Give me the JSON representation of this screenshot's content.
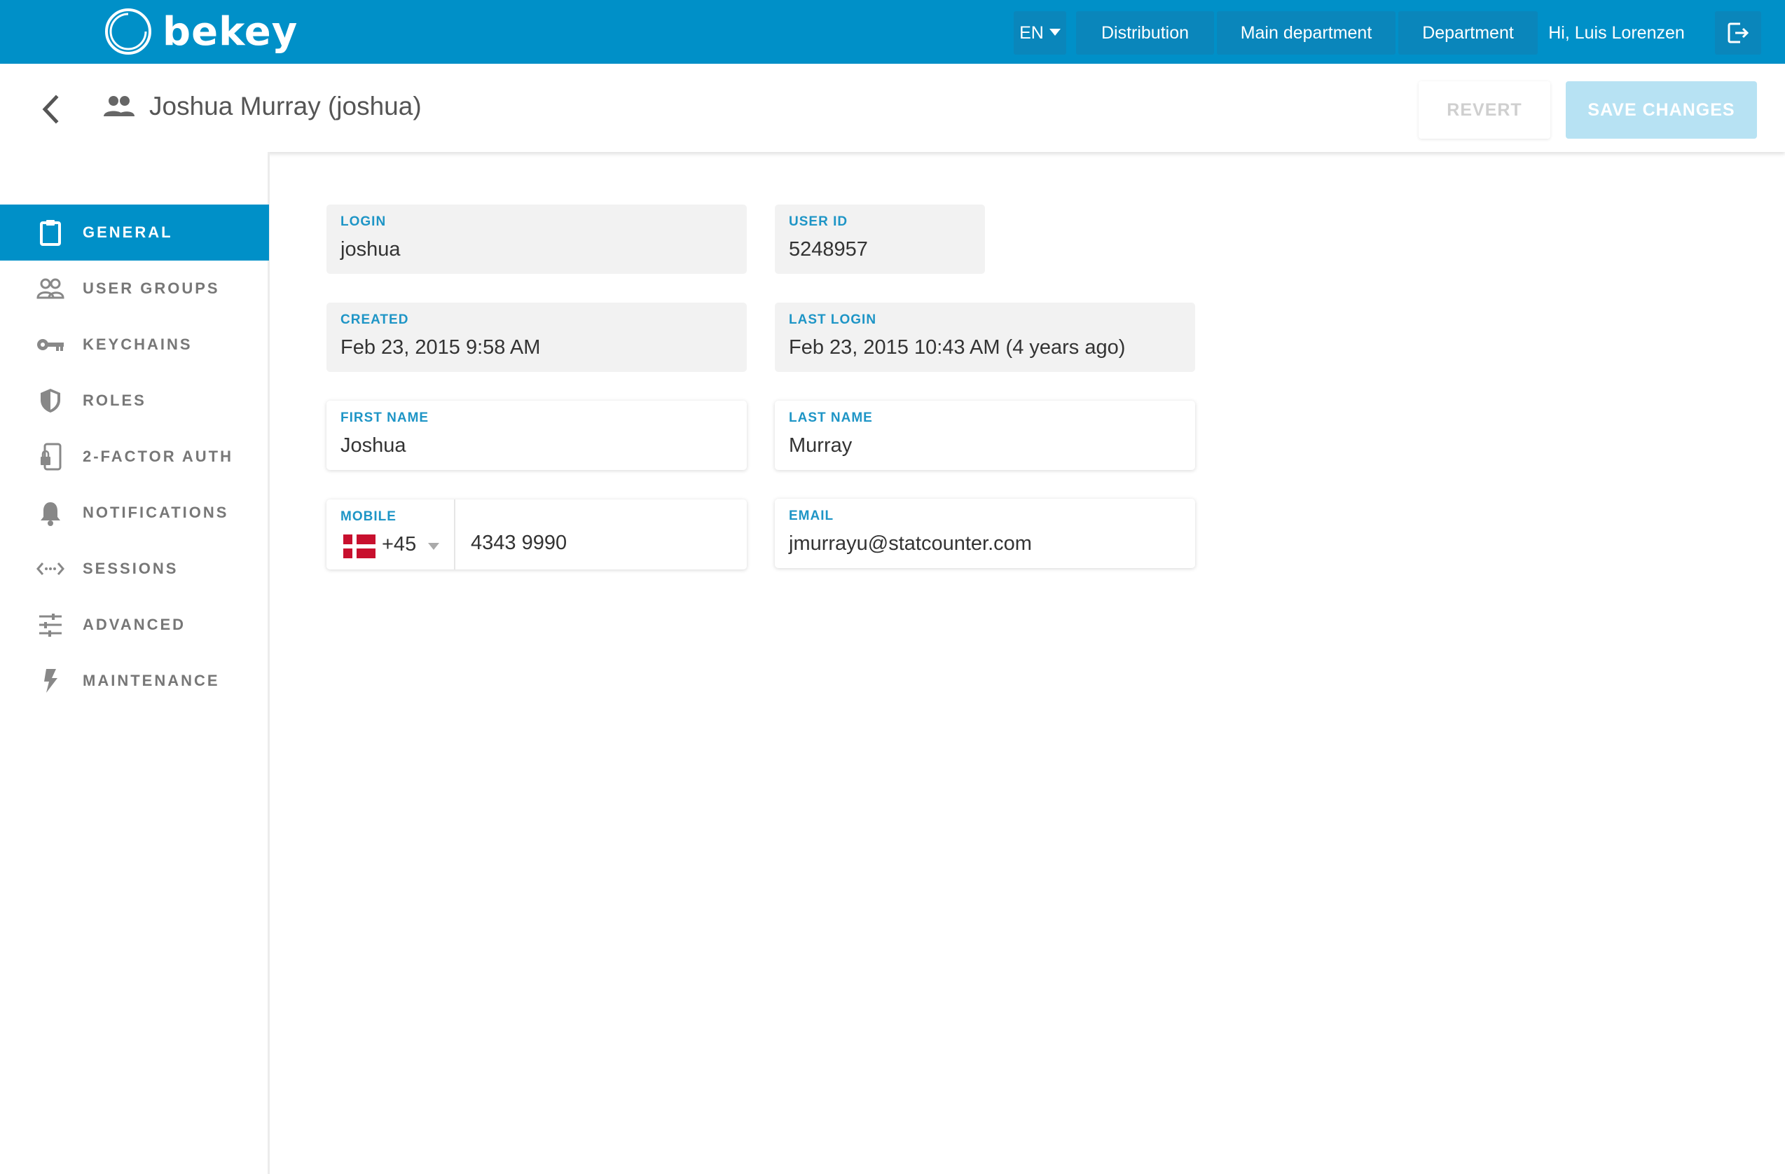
{
  "app": {
    "logo_text": "bekey"
  },
  "topbar": {
    "language": "EN",
    "nav": [
      "Distribution",
      "Main department",
      "Department"
    ],
    "greeting": "Hi, Luis Lorenzen"
  },
  "header": {
    "title": "Joshua Murray (joshua)",
    "revert_label": "REVERT",
    "save_label": "SAVE CHANGES"
  },
  "sidebar": {
    "items": [
      {
        "label": "GENERAL",
        "icon": "clipboard-icon",
        "active": true
      },
      {
        "label": "USER GROUPS",
        "icon": "people-icon"
      },
      {
        "label": "KEYCHAINS",
        "icon": "key-icon"
      },
      {
        "label": "ROLES",
        "icon": "shield-icon"
      },
      {
        "label": "2-FACTOR AUTH",
        "icon": "phone-lock-icon"
      },
      {
        "label": "NOTIFICATIONS",
        "icon": "bell-icon"
      },
      {
        "label": "SESSIONS",
        "icon": "code-dots-icon"
      },
      {
        "label": "ADVANCED",
        "icon": "sliders-icon"
      },
      {
        "label": "MAINTENANCE",
        "icon": "lightning-icon"
      }
    ]
  },
  "form": {
    "login": {
      "label": "LOGIN",
      "value": "joshua"
    },
    "user_id": {
      "label": "USER ID",
      "value": "5248957"
    },
    "created": {
      "label": "CREATED",
      "value": "Feb 23, 2015 9:58 AM"
    },
    "last_login": {
      "label": "LAST LOGIN",
      "value": "Feb 23, 2015 10:43 AM (4 years ago)"
    },
    "first_name": {
      "label": "FIRST NAME",
      "value": "Joshua"
    },
    "last_name": {
      "label": "LAST NAME",
      "value": "Murray"
    },
    "mobile": {
      "label": "MOBILE",
      "country": "Denmark",
      "dial_code": "+45",
      "number": "4343 9990"
    },
    "email": {
      "label": "EMAIL",
      "value": "jmurrayu@statcounter.com"
    }
  },
  "colors": {
    "primary": "#0090c8",
    "label_blue": "#1e95c6",
    "save_disabled": "#b7e2f3"
  }
}
